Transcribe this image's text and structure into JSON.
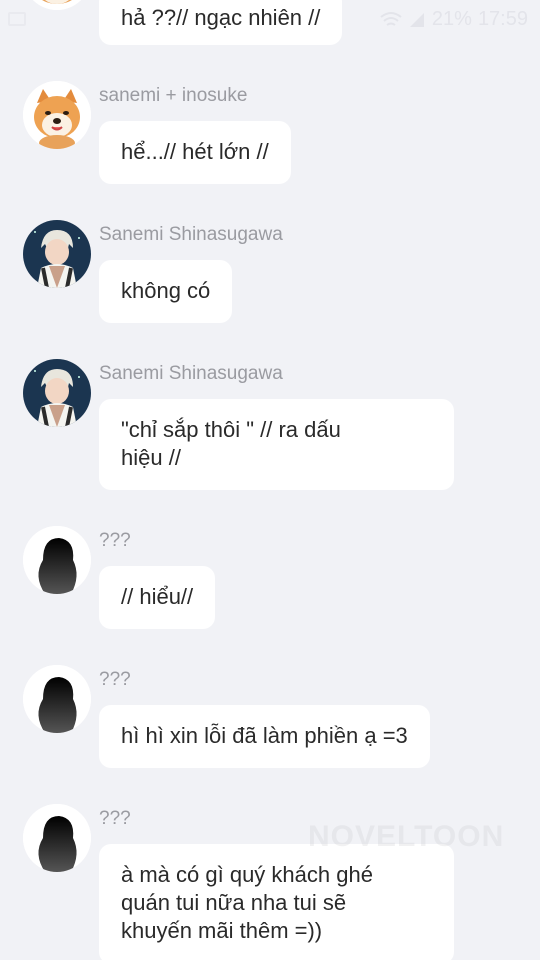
{
  "status_bar": {
    "battery": "21%",
    "time": "17:59",
    "icons": [
      "gallery-icon",
      "wifi-icon",
      "signal-icon"
    ]
  },
  "watermark": "NOVELTOON",
  "messages": [
    {
      "sender": "",
      "avatar": "shiba-avatar",
      "text": "hả ??// ngạc nhiên //"
    },
    {
      "sender": "sanemi + inosuke",
      "avatar": "shiba-avatar",
      "text": "hể...// hét lớn //"
    },
    {
      "sender": "Sanemi Shinasugawa",
      "avatar": "sanemi-avatar",
      "text": "không có"
    },
    {
      "sender": "Sanemi Shinasugawa",
      "avatar": "sanemi-avatar",
      "text_lines": [
        "\"chỉ sắp thôi \" // ra dấu",
        "hiệu //"
      ]
    },
    {
      "sender": "???",
      "avatar": "silhouette-avatar",
      "text": "// hiểu//"
    },
    {
      "sender": "???",
      "avatar": "silhouette-avatar",
      "text": "hì hì xin lỗi đã làm phiền ạ =3"
    },
    {
      "sender": "???",
      "avatar": "silhouette-avatar",
      "text_lines": [
        "à mà có gì quý khách ghé",
        "quán tui nữa nha tui sẽ",
        "khuyến mãi thêm =))"
      ]
    }
  ]
}
